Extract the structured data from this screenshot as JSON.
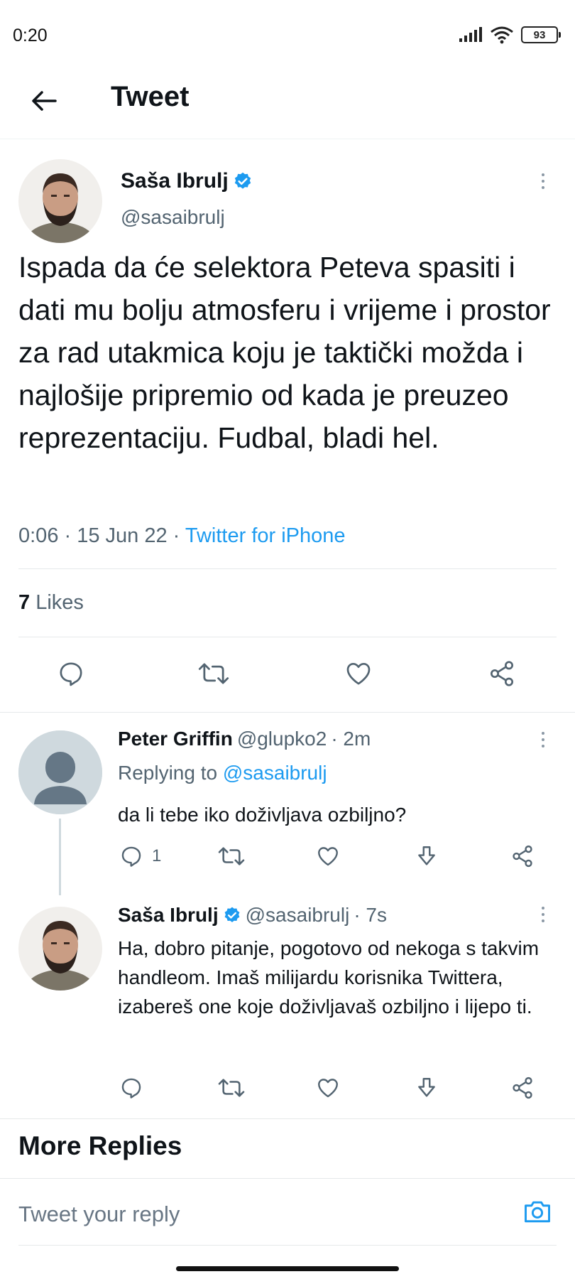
{
  "status_bar": {
    "time": "0:20",
    "battery": "93",
    "icons": [
      "signal-icon",
      "wifi-icon",
      "battery-icon"
    ]
  },
  "header": {
    "title": "Tweet",
    "back_icon": "arrow-left-icon"
  },
  "main_tweet": {
    "author_name": "Saša Ibrulj",
    "handle": "@sasaibrulj",
    "verified": true,
    "text": "Ispada da će selektora Peteva spasiti i dati mu bolju atmosferu i vrijeme i prostor za rad utakmica koju je taktički možda i najlošije pripremio od kada je preuzeo reprezentaciju. Fudbal, bladi hel.",
    "time": "0:06",
    "date": "15 Jun 22",
    "separator": " · ",
    "source": "Twitter for iPhone",
    "likes_count": "7",
    "likes_label": "Likes"
  },
  "replies": [
    {
      "author_name": "Peter Griffin",
      "handle": "@glupko2",
      "time": "· 2m",
      "replying_label": "Replying to",
      "replying_to": "@sasaibrulj",
      "text": "da li tebe iko doživljava ozbiljno?",
      "reply_count": "1"
    },
    {
      "author_name": "Saša Ibrulj",
      "handle": "@sasaibrulj",
      "time": "· 7s",
      "verified": true,
      "text": "Ha, dobro pitanje, pogotovo od nekoga s takvim handleom. Imaš milijardu korisnika Twittera, izabereš one koje doživljavaš ozbiljno i lijepo ti."
    }
  ],
  "more_replies_label": "More Replies",
  "compose": {
    "placeholder": "Tweet your reply"
  },
  "colors": {
    "accent": "#1d9bf0",
    "text": "#0f1419",
    "muted": "#536471"
  }
}
